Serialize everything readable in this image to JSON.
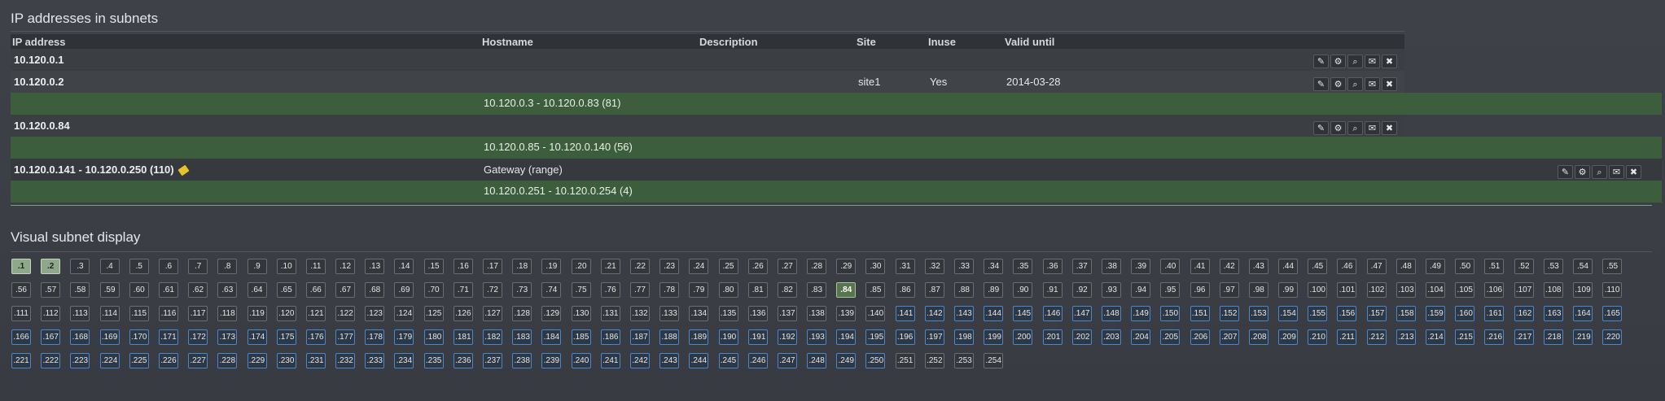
{
  "section1_title": "IP addresses in subnets",
  "section2_title": "Visual subnet display",
  "columns": {
    "ip": "IP address",
    "hostname": "Hostname",
    "description": "Description",
    "site": "Site",
    "inuse": "Inuse",
    "valid": "Valid until"
  },
  "rows": [
    {
      "ip": "10.120.0.1",
      "hostname": "",
      "description": "",
      "site": "",
      "inuse": "",
      "valid": ""
    },
    {
      "ip": "10.120.0.2",
      "hostname": "",
      "description": "",
      "site": "site1",
      "inuse": "Yes",
      "valid": "2014-03-28"
    },
    {
      "free": "10.120.0.3 - 10.120.0.83 (81)"
    },
    {
      "ip": "10.120.0.84",
      "hostname": "",
      "description": "",
      "site": "",
      "inuse": "",
      "valid": ""
    },
    {
      "free": "10.120.0.85 - 10.120.0.140 (56)"
    },
    {
      "ip": "10.120.0.141 - 10.120.0.250 (110)",
      "hostname": "Gateway (range)",
      "tag_icon": "tag-icon"
    },
    {
      "free": "10.120.0.251 - 10.120.0.254 (4)"
    }
  ],
  "action_icons": [
    "pencil-icon",
    "gears-icon",
    "search-icon",
    "envelope-icon",
    "close-icon"
  ],
  "action_glyphs": [
    "✎",
    "⚙",
    "⌕",
    "✉",
    "✖"
  ],
  "subnet_cells_start": 1,
  "subnet_cells_end": 254,
  "subnet_used": [
    1,
    2,
    84
  ],
  "subnet_range": [
    141,
    250
  ],
  "colors": {
    "free_row": "#3d5e3d",
    "used_cell": "#8fa88c",
    "range_border": "#4d86c7"
  }
}
